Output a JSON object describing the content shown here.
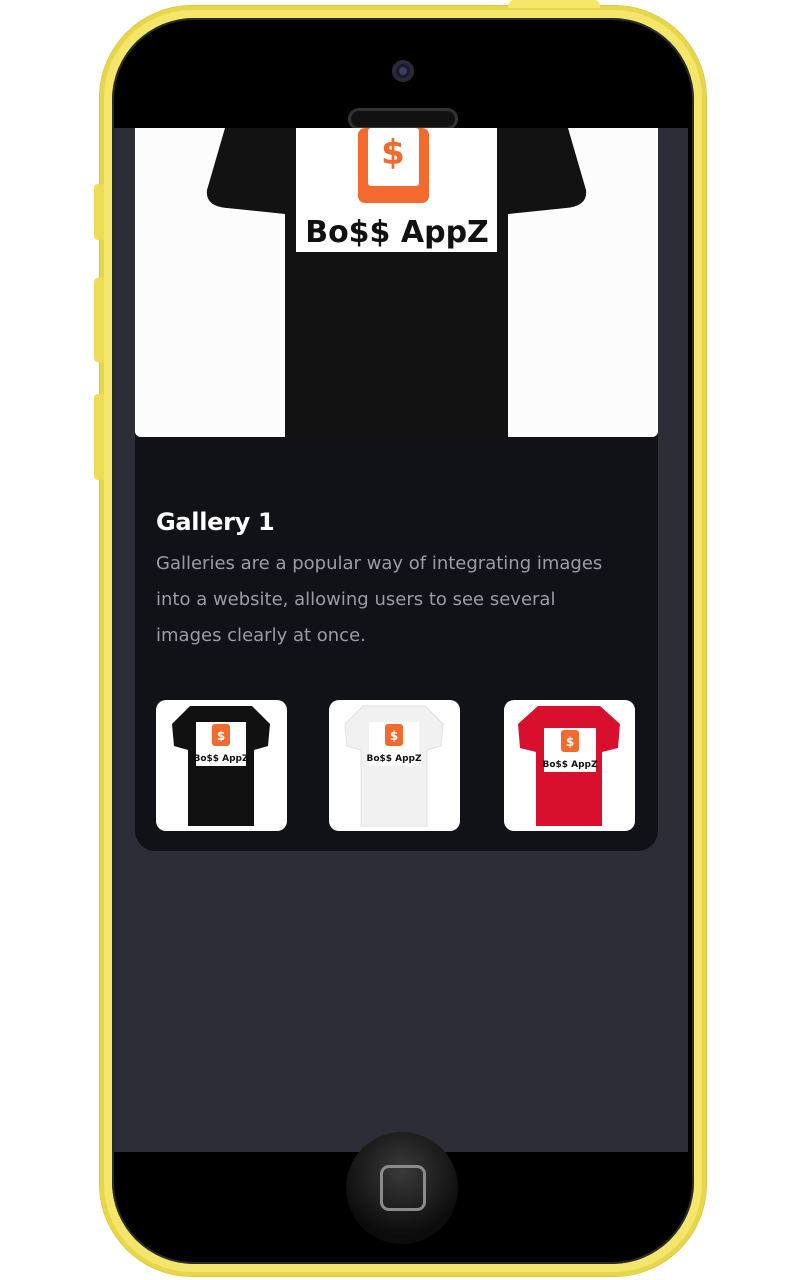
{
  "gallery": {
    "title": "Gallery 1",
    "description": "Galleries are a popular way of integrating images into a website, allowing users to see several images clearly at once."
  },
  "hero": {
    "logo_symbol": "$",
    "logo_text": "Bo$$ AppZ",
    "shirt_color": "#121212"
  },
  "thumbnails": [
    {
      "name": "black-shirt",
      "logo_text": "Bo$$ AppZ",
      "shirt_color": "#111111"
    },
    {
      "name": "white-shirt",
      "logo_text": "Bo$$ AppZ",
      "shirt_color": "#f1f1f1"
    },
    {
      "name": "red-shirt",
      "logo_text": "Bo$$ AppZ",
      "shirt_color": "#d8102e"
    }
  ],
  "colors": {
    "brand_orange": "#f26a2e",
    "phone_frame": "#f3e66a",
    "screen_bg": "#2d2d38",
    "card_bg": "#111218"
  }
}
